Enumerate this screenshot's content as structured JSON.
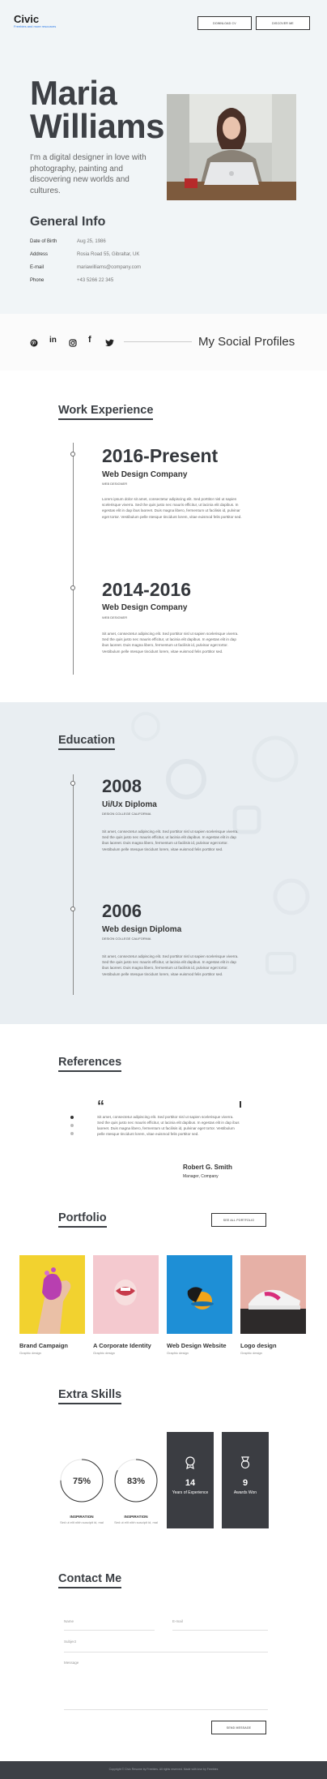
{
  "brand": {
    "name": "Civic",
    "tagline": "Freebies and more resources"
  },
  "header_buttons": {
    "download": "Download CV",
    "discover": "Discover me"
  },
  "hero": {
    "first_name": "Maria",
    "last_name": "Williams",
    "intro": "I'm a digital designer in love with photography, painting and discovering new worlds and cultures."
  },
  "general": {
    "title": "General Info",
    "rows": [
      {
        "label": "Date of Birth",
        "value": "Aug 25, 1986"
      },
      {
        "label": "Address",
        "value": "Rosia Road 55, Gibraltar, UK"
      },
      {
        "label": "E-mail",
        "value": "mariawilliams@company.com"
      },
      {
        "label": "Phone",
        "value": "+43 5266 22 345"
      }
    ]
  },
  "social": {
    "title": "My Social Profiles",
    "icons": [
      "pinterest-icon",
      "linkedin-icon",
      "instagram-icon",
      "facebook-icon",
      "twitter-icon"
    ]
  },
  "work": {
    "title": "Work Experience",
    "items": [
      {
        "period": "2016-Present",
        "company": "Web Design Company",
        "role": "Web Designer",
        "text": "Lorem ipsum dolor sit amet, consectetur adipiscing elit. Sed porttitor nisl ut sapien scelerisque viverra. Sed the quis justo nec mauris efficitur, ut lacinia elit dapibus. In egestas elit in dap ibus laoreet. Duis magna libero, fermentum ut facilisis id, pulvinar eget tortor. Vestibulum pelle ntesque tincidunt lorem, vitae euismod felis porttitor sed."
      },
      {
        "period": "2014-2016",
        "company": "Web Design Company",
        "role": "Web Designer",
        "text": "Sit amet, consectetur adipiscing elit. Sed porttitor nisl ut sapien scelerisque viverra. Sed the quis justo nec mauris efficitur, ut lacinia elit dapibus. In egestas elit in dap ibus laoreet. Duis magna libero, fermentum ut facilisis id, pulvinar eget tortor. Vestibulum pelle ntesque tincidunt lorem, vitae euismod felis porttitor sed."
      }
    ]
  },
  "education": {
    "title": "Education",
    "items": [
      {
        "year": "2008",
        "degree": "Ui/Ux Diploma",
        "school": "Design College California",
        "text": "Sit amet, consectetur adipiscing elit. Sed porttitor nisl ut sapien scelerisque viverra. Sed the quis justo nec mauris efficitur, ut lacinia elit dapibus. In egestas elit in dap ibus laoreet. Duis magna libero, fermentum ut facilisis id, pulvinar eget tortor. Vestibulum pelle ntesque tincidunt lorem, vitae euismod felis porttitor sed."
      },
      {
        "year": "2006",
        "degree": "Web design Diploma",
        "school": "Design College California",
        "text": "Sit amet, consectetur adipiscing elit. Sed porttitor nisl ut sapien scelerisque viverra. Sed the quis justo nec mauris efficitur, ut lacinia elit dapibus. In egestas elit in dap ibus laoreet. Duis magna libero, fermentum ut facilisis id, pulvinar eget tortor. Vestibulum pelle ntesque tincidunt lorem, vitae euismod felis porttitor sed."
      }
    ]
  },
  "references": {
    "title": "References",
    "text": "Sit amet, consectetur adipiscing elit. Sed porttitor nisl ut sapien scelerisque viverra. Sed the quis justo nec mauris efficitur, ut lacinia elit dapibus. In egestas elit in dap ibus laoreet. Duis magna libero, fermentum ut facilisis id, pulvinar eget tortor. Vestibulum pelle ntesque tincidunt lorem, vitae euismod felis porttitor sed.",
    "name": "Robert G. Smith",
    "position": "Manager, Company"
  },
  "portfolio": {
    "title": "Portfolio",
    "see_all": "See all portfolio",
    "items": [
      {
        "title": "Brand Campaign",
        "category": "Graphic design"
      },
      {
        "title": "A Corporate Identity",
        "category": "Graphic design"
      },
      {
        "title": "Web Design Website",
        "category": "Graphic design"
      },
      {
        "title": "Logo design",
        "category": "Graphic design"
      }
    ]
  },
  "skills": {
    "title": "Extra Skills",
    "circles": [
      {
        "percent": "75%",
        "value": 0.75,
        "label": "Inspiration",
        "desc": "Sed ut elit nibh suscipit id, mal"
      },
      {
        "percent": "83%",
        "value": 0.83,
        "label": "Inspiration",
        "desc": "Sed ut elit nibh suscipit id, mal"
      }
    ],
    "cards": [
      {
        "number": "14",
        "label": "Years of Experience",
        "icon": "award-badge-icon"
      },
      {
        "number": "9",
        "label": "Awards Won",
        "icon": "medal-icon"
      }
    ]
  },
  "contact": {
    "title": "Contact Me",
    "name_ph": "Name",
    "email_ph": "E-mail",
    "subject_ph": "Subject",
    "message_ph": "Message",
    "send": "Send message"
  },
  "footer": {
    "text": "Copyright © Civic Resume by Freebies. All rights reserved. Made with love by Freebies"
  },
  "colors": {
    "accent": "#2e7be8",
    "dark_card": "#3b3d42",
    "hero_bg": "#f1f5f7",
    "footer_bg": "#3d4046"
  }
}
